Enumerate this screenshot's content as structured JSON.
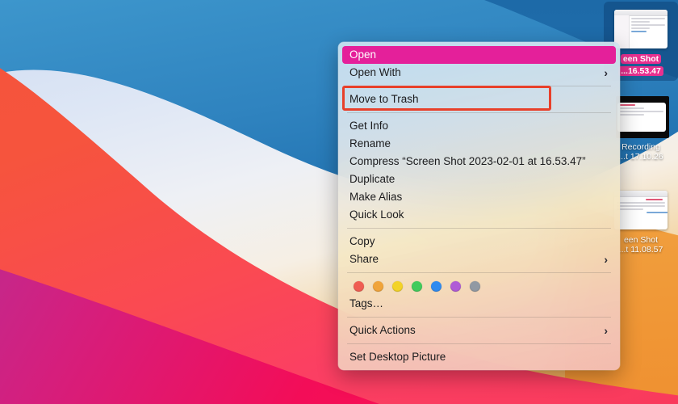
{
  "desktop": {
    "wallpaper_name": "big-sur-waves",
    "colors": {
      "blue": "#2f83bf",
      "white_band": "#eef0f5",
      "red": "#f6543d",
      "orange": "#f0b465",
      "magenta": "#f30d58"
    },
    "icons": [
      {
        "name": "screen-shot-1",
        "label_line1": "een Shot",
        "label_line2": "...16.53.47",
        "selected": true,
        "thumbnail": "document-window-thumbnail"
      },
      {
        "name": "recording-1",
        "label_line1": "Recording",
        "label_line2": "...t 17.10.26",
        "selected": false,
        "thumbnail": "video-frame-thumbnail"
      },
      {
        "name": "screen-shot-2",
        "label_line1": "een Shot",
        "label_line2": "...t 11.08.57",
        "selected": false,
        "thumbnail": "document-window-thumbnail"
      }
    ]
  },
  "context_menu": {
    "highlight_color": "#e4209a",
    "groups": [
      {
        "items": [
          {
            "label": "Open",
            "highlighted": true,
            "submenu": false
          },
          {
            "label": "Open With",
            "highlighted": false,
            "submenu": true
          }
        ]
      },
      {
        "items": [
          {
            "label": "Move to Trash",
            "highlighted": false,
            "submenu": false
          }
        ]
      },
      {
        "items": [
          {
            "label": "Get Info",
            "highlighted": false,
            "submenu": false
          },
          {
            "label": "Rename",
            "highlighted": false,
            "submenu": false
          },
          {
            "label": "Compress “Screen Shot 2023-02-01 at 16.53.47”",
            "highlighted": false,
            "submenu": false
          },
          {
            "label": "Duplicate",
            "highlighted": false,
            "submenu": false
          },
          {
            "label": "Make Alias",
            "highlighted": false,
            "submenu": false
          },
          {
            "label": "Quick Look",
            "highlighted": false,
            "submenu": false
          }
        ]
      },
      {
        "items": [
          {
            "label": "Copy",
            "highlighted": false,
            "submenu": false
          },
          {
            "label": "Share",
            "highlighted": false,
            "submenu": true
          }
        ]
      },
      {
        "tags": [
          {
            "name": "tag-red",
            "color": "#ef5d52"
          },
          {
            "name": "tag-orange",
            "color": "#f0a43a"
          },
          {
            "name": "tag-yellow",
            "color": "#f3d327"
          },
          {
            "name": "tag-green",
            "color": "#41cb5c"
          },
          {
            "name": "tag-blue",
            "color": "#2f8bf0"
          },
          {
            "name": "tag-purple",
            "color": "#b濃"
          },
          {
            "name": "tag-gray",
            "color": "#9199a3"
          }
        ],
        "items": [
          {
            "label": "Tags…",
            "highlighted": false,
            "submenu": false
          }
        ]
      },
      {
        "items": [
          {
            "label": "Quick Actions",
            "highlighted": false,
            "submenu": true
          }
        ]
      },
      {
        "items": [
          {
            "label": "Set Desktop Picture",
            "highlighted": false,
            "submenu": false
          }
        ]
      }
    ]
  },
  "annotation": {
    "name": "move-to-trash-highlight",
    "color": "#e8402a",
    "target_label": "Move to Trash"
  },
  "icons": {
    "submenu_chevron": "›"
  }
}
